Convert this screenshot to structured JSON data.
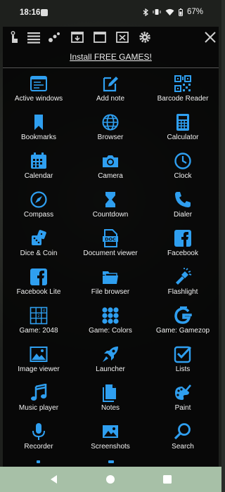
{
  "status": {
    "time": "18:16",
    "battery": "67%"
  },
  "toolbar": {
    "icons": [
      "touch-icon",
      "list-icon",
      "dots-icon",
      "download-window-icon",
      "window-icon",
      "close-window-icon",
      "gear-icon",
      "close-icon"
    ]
  },
  "promo": {
    "label": "Install FREE GAMES!"
  },
  "colors": {
    "accent": "#2f9ff0",
    "overlay": "#0a0a0a",
    "navbar": "#a7c0a7"
  },
  "apps": [
    {
      "label": "Active windows",
      "icon": "windows-icon"
    },
    {
      "label": "Add note",
      "icon": "note-edit-icon"
    },
    {
      "label": "Barcode Reader",
      "icon": "qr-code-icon"
    },
    {
      "label": "Bookmarks",
      "icon": "bookmark-icon"
    },
    {
      "label": "Browser",
      "icon": "globe-icon"
    },
    {
      "label": "Calculator",
      "icon": "calculator-icon"
    },
    {
      "label": "Calendar",
      "icon": "calendar-icon"
    },
    {
      "label": "Camera",
      "icon": "camera-icon"
    },
    {
      "label": "Clock",
      "icon": "clock-icon"
    },
    {
      "label": "Compass",
      "icon": "compass-icon"
    },
    {
      "label": "Countdown",
      "icon": "hourglass-icon"
    },
    {
      "label": "Dialer",
      "icon": "phone-icon"
    },
    {
      "label": "Dice & Coin",
      "icon": "dice-icon"
    },
    {
      "label": "Document viewer",
      "icon": "document-icon"
    },
    {
      "label": "Facebook",
      "icon": "facebook-icon"
    },
    {
      "label": "Facebook Lite",
      "icon": "facebook-lite-icon"
    },
    {
      "label": "File browser",
      "icon": "folder-icon"
    },
    {
      "label": "Flashlight",
      "icon": "flashlight-icon"
    },
    {
      "label": "Game: 2048",
      "icon": "grid-2048-icon"
    },
    {
      "label": "Game: Colors",
      "icon": "dots-grid-icon"
    },
    {
      "label": "Game: Gamezop",
      "icon": "gamezop-icon"
    },
    {
      "label": "Image viewer",
      "icon": "image-icon"
    },
    {
      "label": "Launcher",
      "icon": "rocket-icon"
    },
    {
      "label": "Lists",
      "icon": "checkbox-list-icon"
    },
    {
      "label": "Music player",
      "icon": "music-note-icon"
    },
    {
      "label": "Notes",
      "icon": "notes-icon"
    },
    {
      "label": "Paint",
      "icon": "palette-icon"
    },
    {
      "label": "Recorder",
      "icon": "microphone-icon"
    },
    {
      "label": "Screenshots",
      "icon": "screenshot-icon"
    },
    {
      "label": "Search",
      "icon": "magnifier-icon"
    }
  ],
  "navbar": {
    "buttons": [
      "back-icon",
      "home-icon",
      "recents-icon"
    ]
  }
}
